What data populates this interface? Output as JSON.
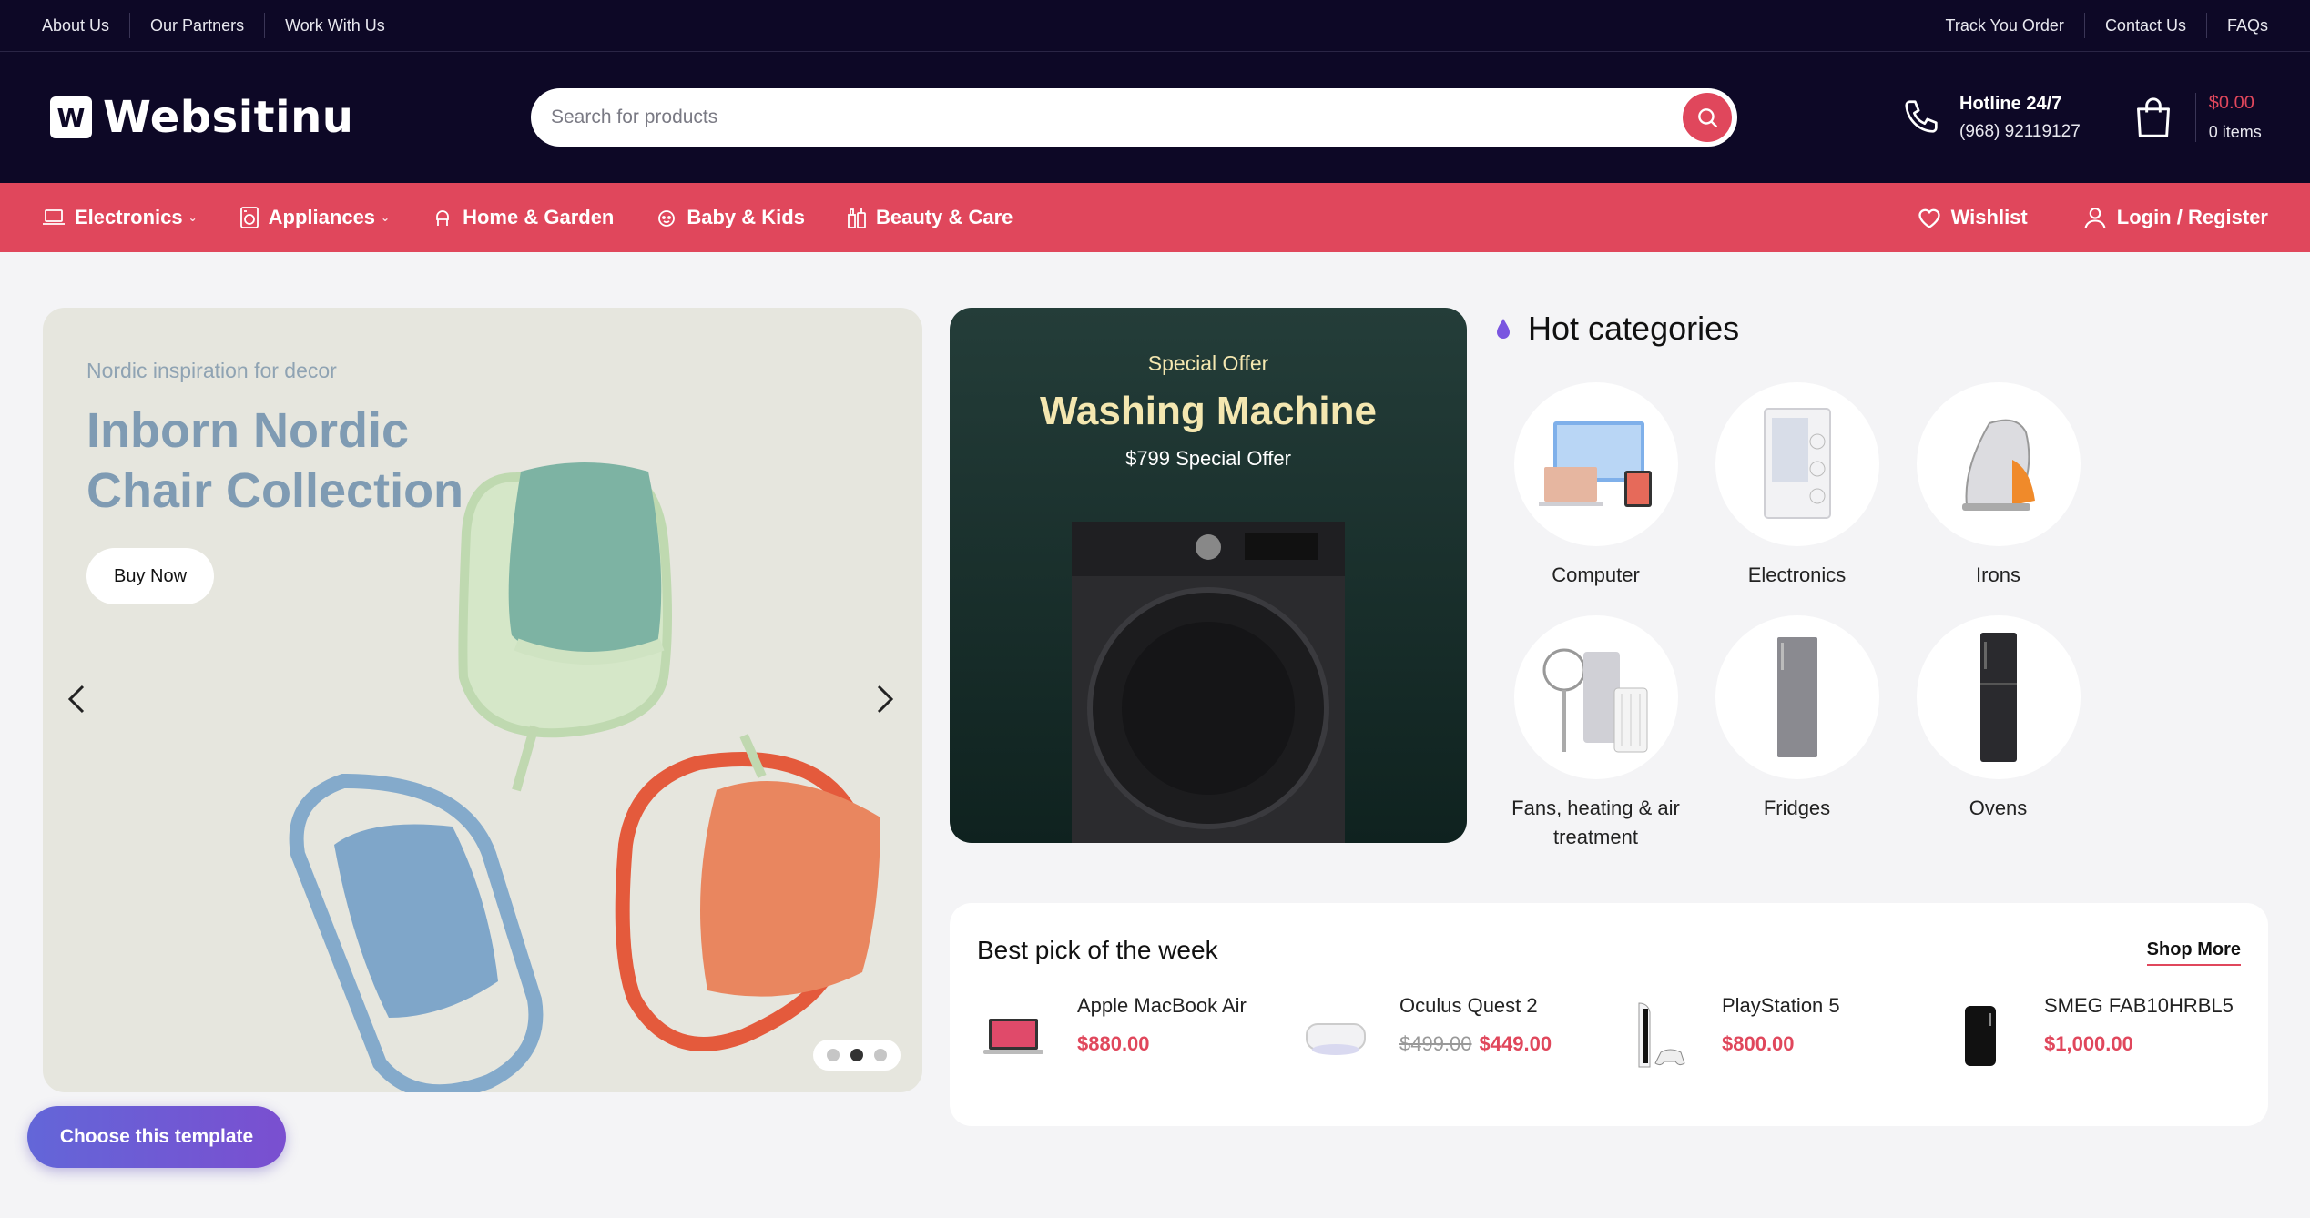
{
  "topbar": {
    "left": [
      "About Us",
      "Our Partners",
      "Work With Us"
    ],
    "right": [
      "Track You Order",
      "Contact Us",
      "FAQs"
    ]
  },
  "header": {
    "logo_letter": "W",
    "logo_text": "Websitinu",
    "search_placeholder": "Search for products",
    "hotline_label": "Hotline 24/7",
    "hotline_number": "(968) 92119127",
    "cart_total": "$0.00",
    "cart_items": "0 items"
  },
  "nav": {
    "items": [
      "Electronics",
      "Appliances",
      "Home & Garden",
      "Baby & Kids",
      "Beauty & Care"
    ],
    "wishlist": "Wishlist",
    "login": "Login / Register"
  },
  "hero": {
    "subtitle": "Nordic inspiration for decor",
    "title": "Inborn Nordic Chair Collection",
    "button": "Buy Now",
    "slide_index": 2,
    "slide_count": 3
  },
  "offer": {
    "label": "Special Offer",
    "title": "Washing Machine",
    "price_text": "$799 Special Offer"
  },
  "hot": {
    "title": "Hot categories",
    "categories": [
      "Computer",
      "Electronics",
      "Irons",
      "Fans, heating & air treatment",
      "Fridges",
      "Ovens"
    ]
  },
  "best": {
    "title": "Best pick of the week",
    "shop_more": "Shop More",
    "items": [
      {
        "name": "Apple MacBook Air",
        "old_price": "",
        "price": "$880.00"
      },
      {
        "name": "Oculus Quest 2",
        "old_price": "$499.00",
        "price": "$449.00"
      },
      {
        "name": "PlayStation 5",
        "old_price": "",
        "price": "$800.00"
      },
      {
        "name": "SMEG FAB10HRBL5",
        "old_price": "",
        "price": "$1,000.00"
      }
    ]
  },
  "float_button": "Choose this template",
  "colors": {
    "accent": "#e0475c",
    "dark": "#0d0826",
    "offer_bg": "#1a302c",
    "hero_bg": "#e6e6de",
    "choose_btn": "#6a5ad6"
  }
}
